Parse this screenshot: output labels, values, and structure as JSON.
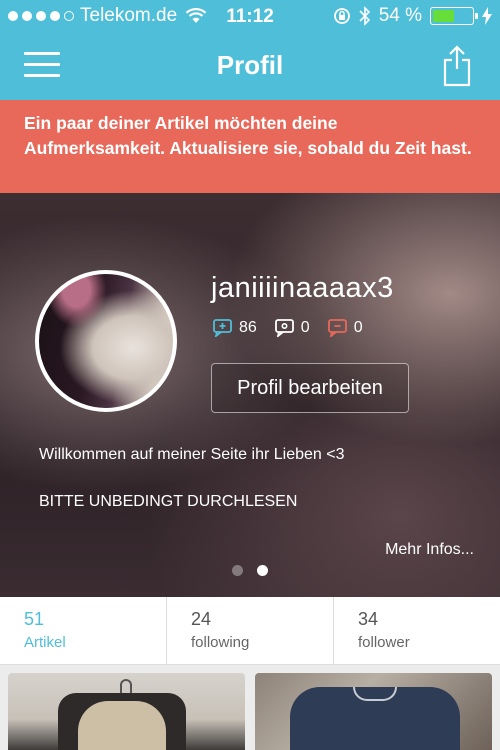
{
  "status_bar": {
    "carrier": "Telekom.de",
    "time": "11:12",
    "battery": "54 %",
    "battery_level": 0.54
  },
  "nav": {
    "title": "Profil",
    "menu_icon": "hamburger-menu-icon",
    "share_icon": "share-icon"
  },
  "alert": {
    "text": "Ein paar deiner Artikel möchten deine Aufmerksamkeit. Aktualisiere sie, sobald du Zeit hast."
  },
  "profile": {
    "username": "janiiiinaaaax3",
    "stats": [
      {
        "icon": "positive-rating-icon",
        "value": "86",
        "color": "#4fbfd9"
      },
      {
        "icon": "neutral-rating-icon",
        "value": "0",
        "color": "#ffffff"
      },
      {
        "icon": "negative-rating-icon",
        "value": "0",
        "color": "#e8685a"
      }
    ],
    "edit_button": "Profil bearbeiten",
    "bio_line1": "Willkommen auf meiner Seite ihr Lieben <3",
    "bio_line2": "BITTE UNBEDINGT DURCHLESEN",
    "more_link": "Mehr Infos...",
    "page_count": 2,
    "active_page": 2
  },
  "counts": [
    {
      "num": "51",
      "label": "Artikel",
      "active": true
    },
    {
      "num": "24",
      "label": "following",
      "active": false
    },
    {
      "num": "34",
      "label": "follower",
      "active": false
    }
  ],
  "colors": {
    "accent": "#4fbfd9",
    "alert": "#e8685a"
  }
}
